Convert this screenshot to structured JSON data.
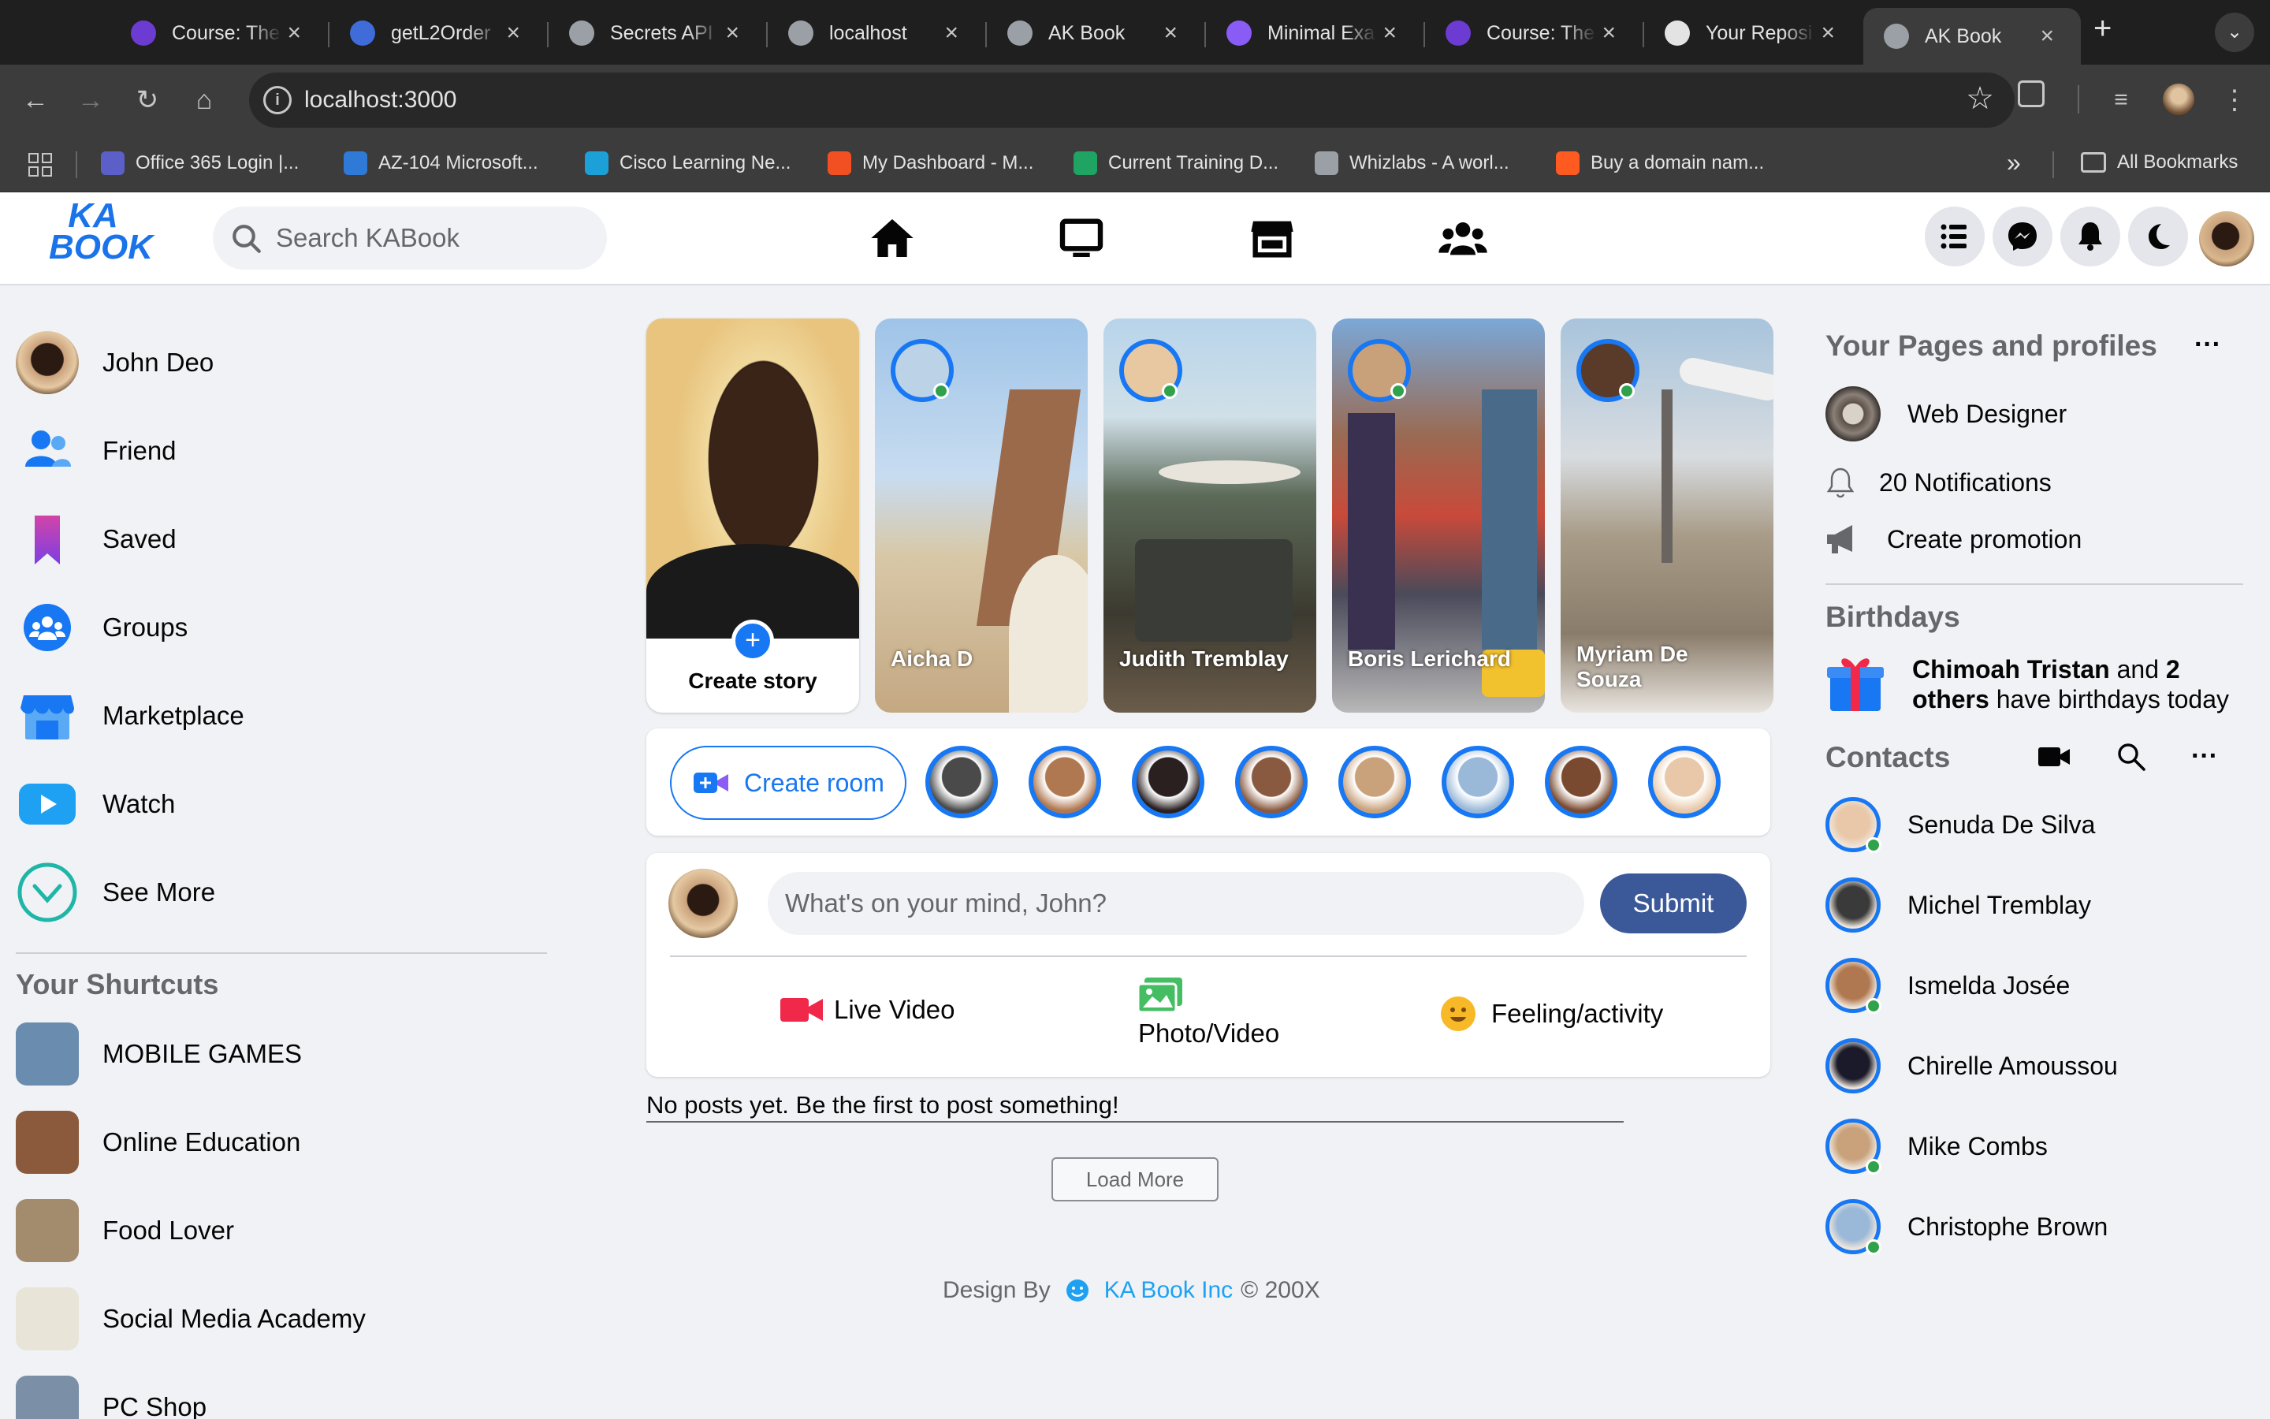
{
  "browser": {
    "tabs": [
      {
        "title": "Course: The",
        "color": "#6c3bd1"
      },
      {
        "title": "getL2Order",
        "color": "#3f6cd9"
      },
      {
        "title": "Secrets API",
        "color": "#9aa0a6"
      },
      {
        "title": "localhost",
        "color": "#9aa0a6"
      },
      {
        "title": "AK Book",
        "color": "#9aa0a6"
      },
      {
        "title": "Minimal Exa",
        "color": "#8a5cf6"
      },
      {
        "title": "Course: The",
        "color": "#6c3bd1"
      },
      {
        "title": "Your Reposi",
        "color": "#e3e3e3"
      },
      {
        "title": "AK Book",
        "color": "#9aa0a6"
      }
    ],
    "url": "localhost:3000",
    "bookmarks": [
      {
        "label": "Office 365 Login |...",
        "color": "#5b5fc7"
      },
      {
        "label": "AZ-104 Microsoft...",
        "color": "#2f7ad6"
      },
      {
        "label": "Cisco Learning Ne...",
        "color": "#1ba0d7"
      },
      {
        "label": "My Dashboard - M...",
        "color": "#f25022"
      },
      {
        "label": "Current Training D...",
        "color": "#1fa463"
      },
      {
        "label": "Whizlabs - A worl...",
        "color": "#9aa0a6"
      },
      {
        "label": "Buy a domain nam...",
        "color": "#ff5a1f"
      }
    ],
    "all_bookmarks": "All Bookmarks",
    "more": "»"
  },
  "header": {
    "logo_top": "KA",
    "logo_bottom": "BOOK",
    "search_placeholder": "Search KABook"
  },
  "left_menu": [
    {
      "label": "John Deo"
    },
    {
      "label": "Friend"
    },
    {
      "label": "Saved"
    },
    {
      "label": "Groups"
    },
    {
      "label": "Marketplace"
    },
    {
      "label": "Watch"
    },
    {
      "label": "See More"
    }
  ],
  "shortcuts_title": "Your Shurtcuts",
  "shortcuts": [
    {
      "label": "MOBILE GAMES",
      "color": "#6a8caf"
    },
    {
      "label": "Online Education",
      "color": "#8b5a3c"
    },
    {
      "label": "Food Lover",
      "color": "#a38b6d"
    },
    {
      "label": "Social Media Academy",
      "color": "#e8e4d8"
    },
    {
      "label": "PC Shop",
      "color": "#7b8fa6"
    }
  ],
  "stories": {
    "create_label": "Create story",
    "create_plus": "+",
    "items": [
      {
        "name": "Aicha D"
      },
      {
        "name": "Judith Tremblay"
      },
      {
        "name": "Boris Lerichard"
      },
      {
        "name": "Myriam De Souza"
      }
    ]
  },
  "room": {
    "button_label": "Create room",
    "avatar_colors": [
      "#4a4a4a",
      "#b07850",
      "#2a2020",
      "#8a5a40",
      "#c9a27c",
      "#9ab8d8",
      "#7a4a30",
      "#e8c8a8"
    ]
  },
  "composer": {
    "placeholder": "What's on your mind, John?",
    "submit_label": "Submit",
    "actions": {
      "live": "Live Video",
      "photo": "Photo/Video",
      "feeling": "Feeling/activity"
    }
  },
  "feed": {
    "empty_message": "No posts yet. Be the first to post something!",
    "load_more": "Load More"
  },
  "footer": {
    "design_by": "Design By",
    "company": "KA Book Inc",
    "copyright": "© 200X"
  },
  "right": {
    "pages_title": "Your Pages and profiles",
    "page_name": "Web Designer",
    "notifications": "20 Notifications",
    "promotion": "Create promotion",
    "birthdays_title": "Birthdays",
    "birthday_name": "Chimoah Tristan",
    "birthday_and": "and",
    "birthday_others": "2 others",
    "birthday_rest": "have birthdays today",
    "contacts_title": "Contacts",
    "more": "···",
    "contacts": [
      {
        "name": "Senuda De Silva",
        "online": true
      },
      {
        "name": "Michel Tremblay",
        "online": false
      },
      {
        "name": "Ismelda Josée",
        "online": true
      },
      {
        "name": "Chirelle Amoussou",
        "online": false
      },
      {
        "name": "Mike Combs",
        "online": true
      },
      {
        "name": "Christophe Brown",
        "online": true
      }
    ]
  }
}
